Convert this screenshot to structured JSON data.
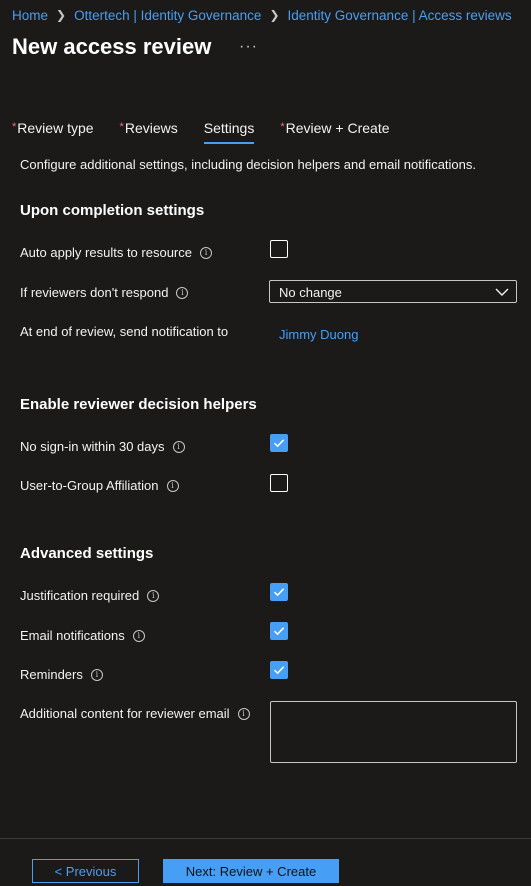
{
  "breadcrumb": {
    "items": [
      "Home",
      "Ottertech | Identity Governance",
      "Identity Governance | Access reviews"
    ]
  },
  "page": {
    "title": "New access review",
    "more_icon": "ellipsis-icon"
  },
  "tabs": [
    {
      "label": "Review type",
      "required": true,
      "active": false
    },
    {
      "label": "Reviews",
      "required": true,
      "active": false
    },
    {
      "label": "Settings",
      "required": false,
      "active": true
    },
    {
      "label": "Review + Create",
      "required": true,
      "active": false
    }
  ],
  "description": "Configure additional settings, including decision helpers and email notifications.",
  "completion": {
    "title": "Upon completion settings",
    "auto_apply_label": "Auto apply results to resource",
    "auto_apply_checked": false,
    "no_response_label": "If reviewers don't respond",
    "no_response_value": "No change",
    "notify_label": "At end of review, send notification to",
    "notify_value": "Jimmy Duong"
  },
  "helpers": {
    "title": "Enable reviewer decision helpers",
    "no_signin_label": "No sign-in within 30 days",
    "no_signin_checked": true,
    "affiliation_label": "User-to-Group Affiliation",
    "affiliation_checked": false
  },
  "advanced": {
    "title": "Advanced settings",
    "justification_label": "Justification required",
    "justification_checked": true,
    "email_label": "Email notifications",
    "email_checked": true,
    "reminders_label": "Reminders",
    "reminders_checked": true,
    "additional_label": "Additional content for reviewer email",
    "additional_value": ""
  },
  "footer": {
    "previous_label": "< Previous",
    "next_label": "Next: Review + Create"
  },
  "colors": {
    "accent": "#479ef5",
    "background": "#1b1a19",
    "required": "#f1707b"
  }
}
